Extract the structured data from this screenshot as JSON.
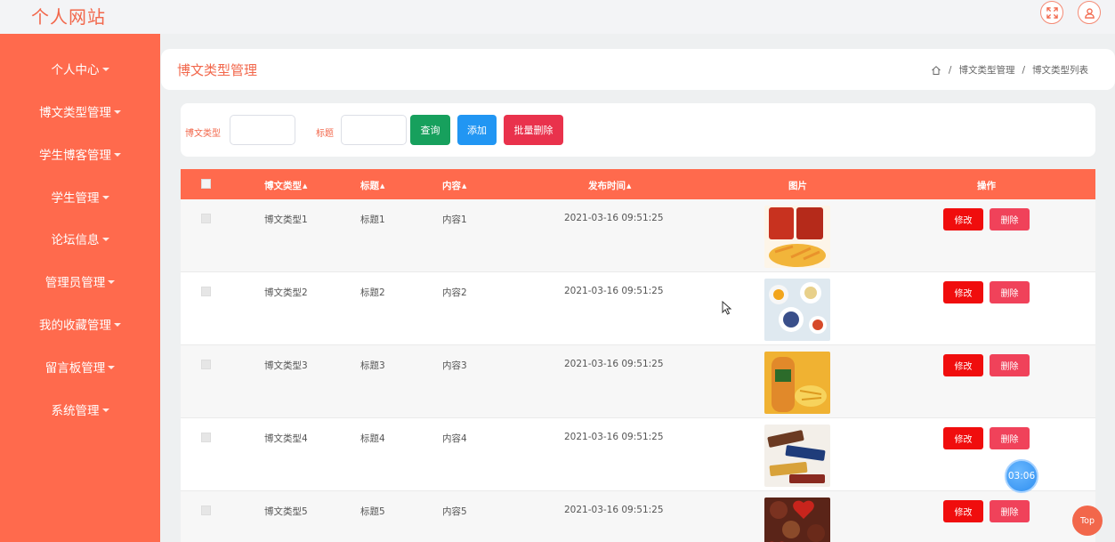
{
  "site": {
    "title": "个人网站"
  },
  "header": {
    "fullscreen_icon": "fullscreen-icon",
    "user_icon": "user-icon"
  },
  "sidebar": {
    "items": [
      {
        "label": "个人中心"
      },
      {
        "label": "博文类型管理"
      },
      {
        "label": "学生博客管理"
      },
      {
        "label": "学生管理"
      },
      {
        "label": "论坛信息"
      },
      {
        "label": "管理员管理"
      },
      {
        "label": "我的收藏管理"
      },
      {
        "label": "留言板管理"
      },
      {
        "label": "系统管理"
      }
    ]
  },
  "page": {
    "title": "博文类型管理",
    "breadcrumb": [
      "博文类型管理",
      "博文类型列表"
    ]
  },
  "search": {
    "type_label": "博文类型",
    "title_label": "标题",
    "query_button": "查询",
    "add_button": "添加",
    "batch_delete_button": "批量删除"
  },
  "table": {
    "columns": [
      "博文类型",
      "标题",
      "内容",
      "发布时间",
      "图片",
      "操作"
    ],
    "edit_label": "修改",
    "delete_label": "删除",
    "rows": [
      {
        "type": "博文类型1",
        "title": "标题1",
        "content": "内容1",
        "time": "2021-03-16 09:51:25"
      },
      {
        "type": "博文类型2",
        "title": "标题2",
        "content": "内容2",
        "time": "2021-03-16 09:51:25"
      },
      {
        "type": "博文类型3",
        "title": "标题3",
        "content": "内容3",
        "time": "2021-03-16 09:51:25"
      },
      {
        "type": "博文类型4",
        "title": "标题4",
        "content": "内容4",
        "time": "2021-03-16 09:51:25"
      },
      {
        "type": "博文类型5",
        "title": "标题5",
        "content": "内容5",
        "time": "2021-03-16 09:51:25"
      }
    ]
  },
  "widgets": {
    "timer": "03:06",
    "top": "Top"
  },
  "colors": {
    "accent": "#ff6a4d",
    "title": "#f2674b",
    "green": "#17a05d",
    "blue": "#2196f3",
    "danger": "#e9324c",
    "edit": "#f00d0d",
    "delete": "#f0425a"
  }
}
